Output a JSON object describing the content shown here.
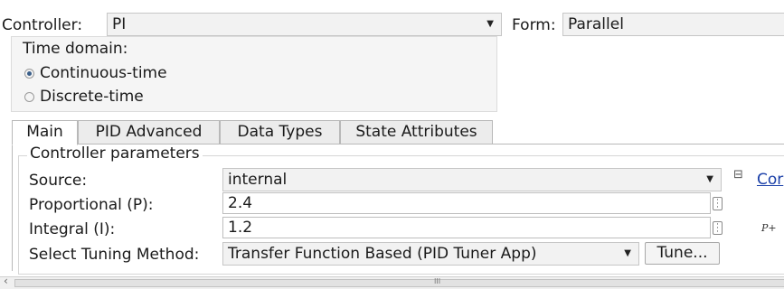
{
  "header": {
    "controller_label": "Controller:",
    "controller_value": "PI",
    "form_label": "Form:",
    "form_value": "Parallel"
  },
  "time_domain": {
    "title": "Time domain:",
    "options": [
      {
        "label": "Continuous-time",
        "selected": true
      },
      {
        "label": "Discrete-time",
        "selected": false
      }
    ]
  },
  "tabs": [
    {
      "label": "Main",
      "active": true
    },
    {
      "label": "PID Advanced",
      "active": false
    },
    {
      "label": "Data Types",
      "active": false
    },
    {
      "label": "State Attributes",
      "active": false
    }
  ],
  "controller_parameters": {
    "title": "Controller parameters",
    "source_label": "Source:",
    "source_value": "internal",
    "proportional_label": "Proportional (P):",
    "proportional_value": "2.4",
    "integral_label": "Integral (I):",
    "integral_value": "1.2",
    "tuning_label": "Select Tuning Method:",
    "tuning_value": "Transfer Function Based (PID Tuner App)",
    "tune_button": "Tune..."
  },
  "side_panel": {
    "collapse_glyph": "⊟",
    "link_text": "Cor",
    "formula_text": "P+"
  },
  "scrollbar": {
    "left_arrow": "‹",
    "thumb_grip": "III"
  },
  "icons": {
    "dropdown": "chevron-down-icon",
    "ellipsis": "ellipsis-icon",
    "collapse": "collapse-box-icon"
  }
}
